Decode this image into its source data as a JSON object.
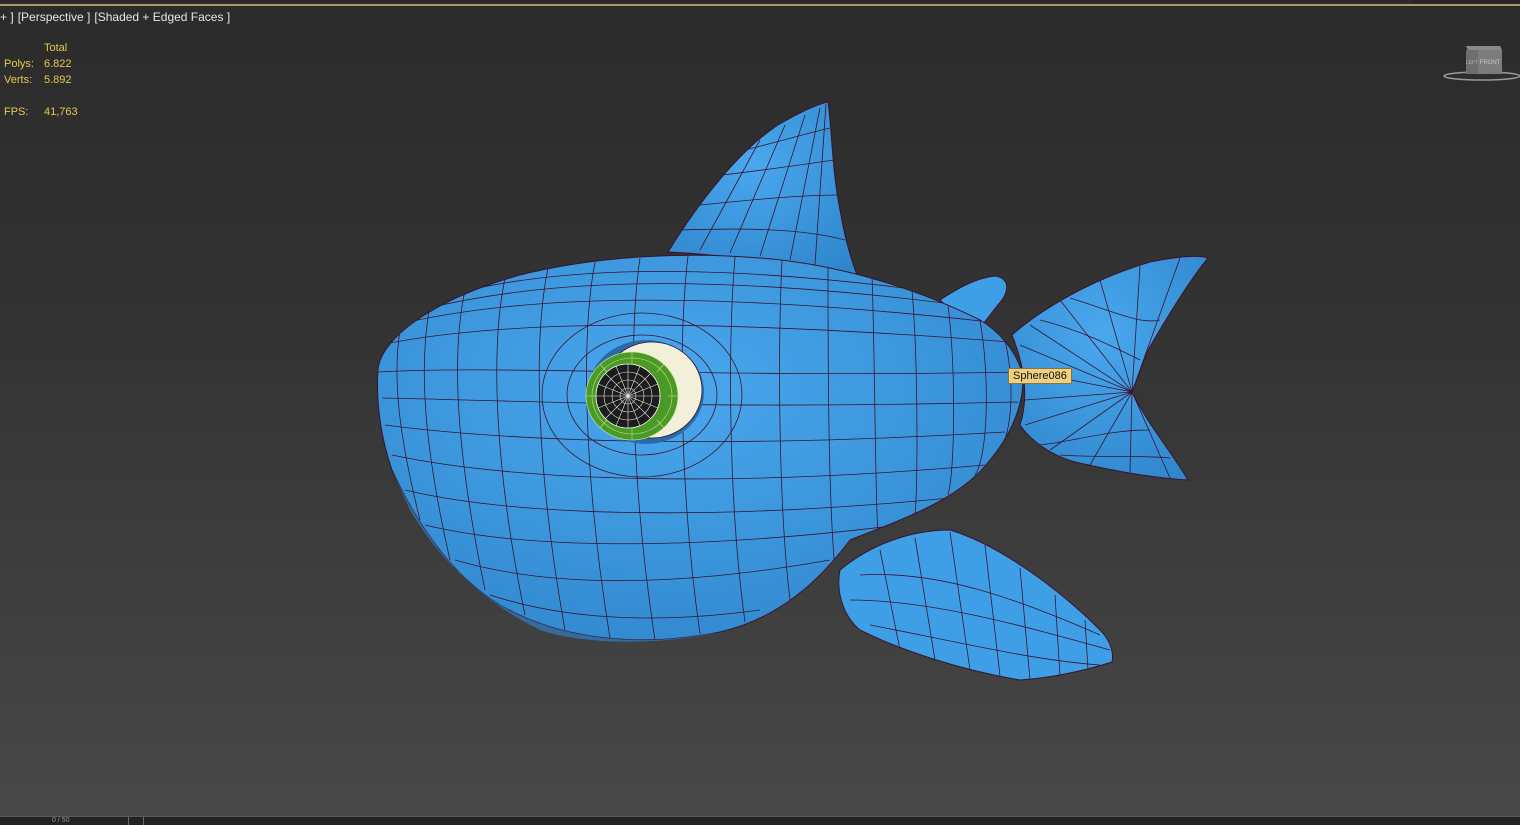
{
  "viewport": {
    "menu_label": "+ ]",
    "view_label": "[Perspective ]",
    "shading_label": "[Shaded + Edged Faces ]"
  },
  "stats": {
    "total_header": "Total",
    "polys_label": "Polys:",
    "polys_value": "6.822",
    "verts_label": "Verts:",
    "verts_value": "5.892",
    "fps_label": "FPS:",
    "fps_value": "41,763"
  },
  "viewcube": {
    "face_label": "FRONT",
    "corner_label": "LEFT"
  },
  "tooltip": {
    "object_name": "Sphere086"
  },
  "model": {
    "body_color": "#3f9fe6",
    "body_shadow_color": "#2e7fc2",
    "edge_color": "#3a1430",
    "eye_white_color": "#f2f0d8",
    "iris_color": "#4a9a28",
    "pupil_color": "#1c1c1c"
  },
  "status_bar": {
    "frame_text": "0 / 50"
  }
}
